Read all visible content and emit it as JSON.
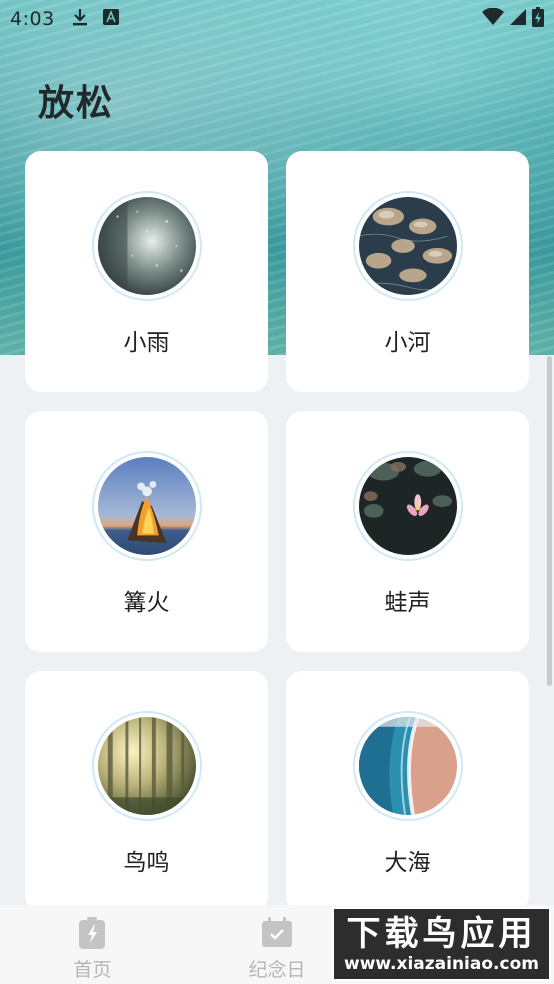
{
  "status_bar": {
    "time": "4:03",
    "icons": [
      "download-icon",
      "a-icon",
      "wifi-icon",
      "signal-icon",
      "battery-icon"
    ]
  },
  "page": {
    "title": "放松"
  },
  "cards": [
    {
      "label": "小雨",
      "image": "rain-window"
    },
    {
      "label": "小河",
      "image": "river-stones"
    },
    {
      "label": "篝火",
      "image": "campfire"
    },
    {
      "label": "蛙声",
      "image": "lotus-pond"
    },
    {
      "label": "鸟鸣",
      "image": "forest"
    },
    {
      "label": "大海",
      "image": "beach-waves"
    }
  ],
  "tabbar": {
    "tabs": [
      {
        "label": "首页",
        "icon": "battery-bolt-icon"
      },
      {
        "label": "纪念日",
        "icon": "calendar-check-icon"
      },
      {
        "label": "",
        "icon": "third-tab-icon"
      }
    ]
  },
  "watermark": {
    "title": "下载鸟应用",
    "url": "www.xiazainiao.com"
  },
  "colors": {
    "accent_teal": "#44a7ac",
    "background": "#eef1f4",
    "tab_inactive": "#b5b5b5"
  }
}
